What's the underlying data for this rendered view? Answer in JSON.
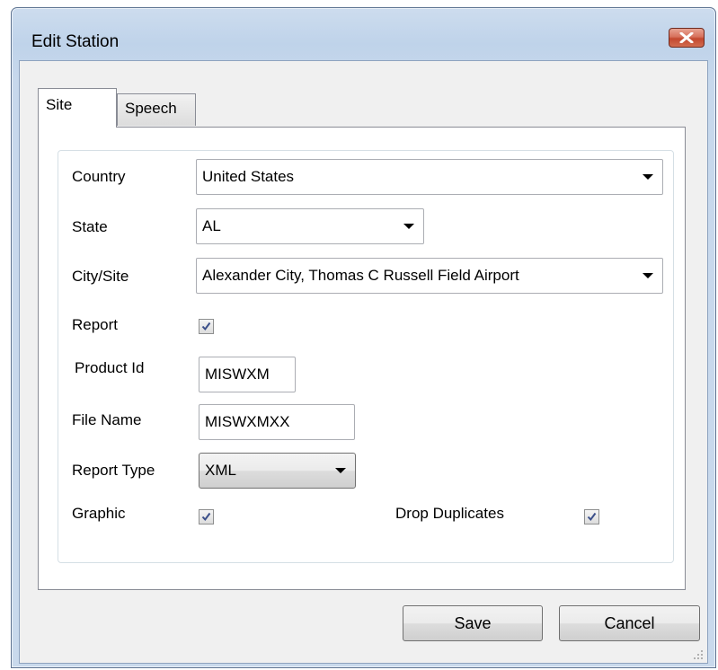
{
  "window": {
    "title": "Edit Station",
    "close_icon": "close-icon"
  },
  "tabs": [
    {
      "label": "Site",
      "selected": true
    },
    {
      "label": "Speech",
      "selected": false
    }
  ],
  "form": {
    "country": {
      "label": "Country",
      "value": "United States"
    },
    "state": {
      "label": "State",
      "value": "AL"
    },
    "city_site": {
      "label": "City/Site",
      "value": "Alexander City, Thomas C Russell Field Airport"
    },
    "report": {
      "label": "Report",
      "checked": true
    },
    "product_id": {
      "label": "Product Id",
      "value": "MISWXM"
    },
    "file_name": {
      "label": "File Name",
      "value": "MISWXMXX"
    },
    "report_type": {
      "label": "Report Type",
      "value": "XML"
    },
    "graphic": {
      "label": "Graphic",
      "checked": true
    },
    "drop_duplicates": {
      "label": "Drop Duplicates",
      "checked": true
    }
  },
  "buttons": {
    "save_label": "Save",
    "cancel_label": "Cancel"
  }
}
